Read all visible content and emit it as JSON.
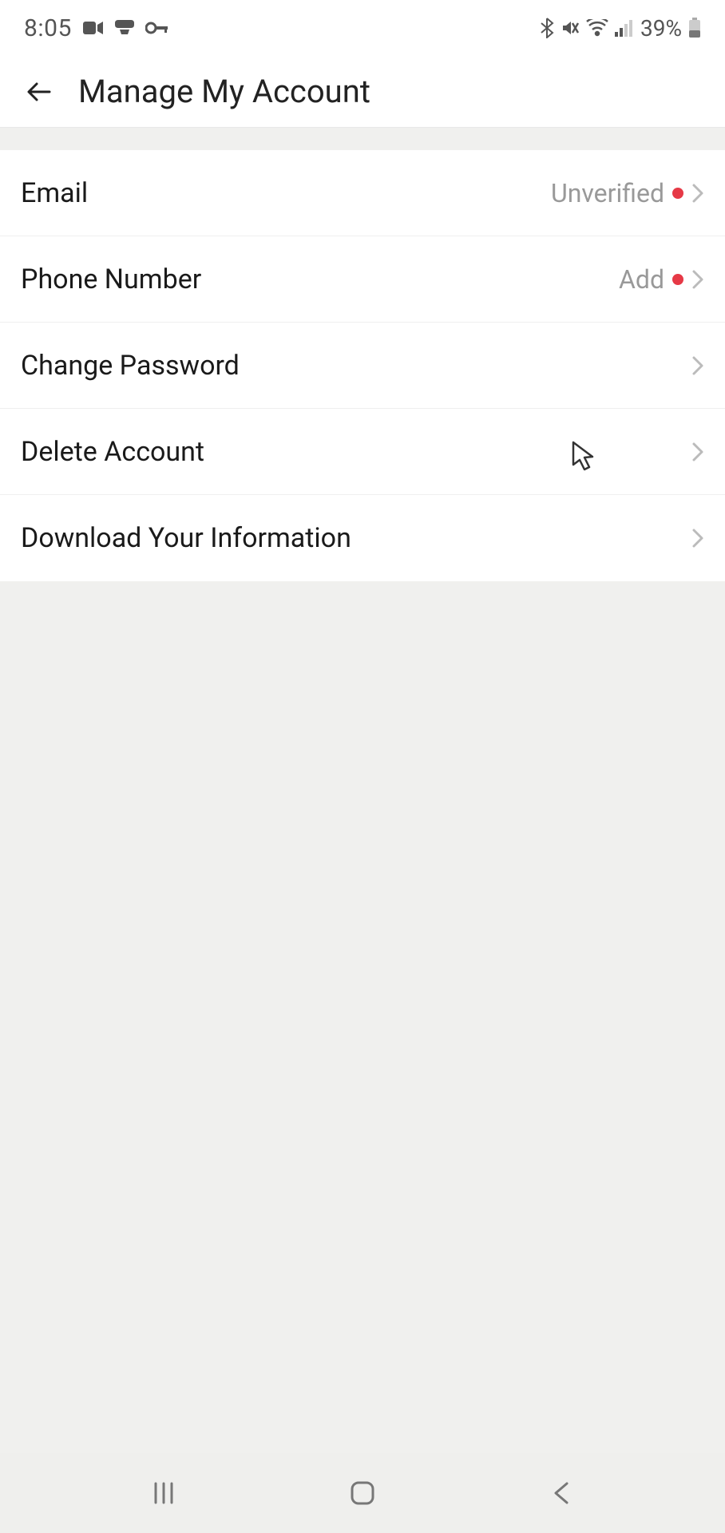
{
  "statusBar": {
    "time": "8:05",
    "battery": "39%"
  },
  "header": {
    "title": "Manage My Account"
  },
  "items": [
    {
      "label": "Email",
      "status": "Unverified",
      "hasDot": true
    },
    {
      "label": "Phone Number",
      "status": "Add",
      "hasDot": true
    },
    {
      "label": "Change Password",
      "status": "",
      "hasDot": false
    },
    {
      "label": "Delete Account",
      "status": "",
      "hasDot": false
    },
    {
      "label": "Download Your Information",
      "status": "",
      "hasDot": false
    }
  ]
}
